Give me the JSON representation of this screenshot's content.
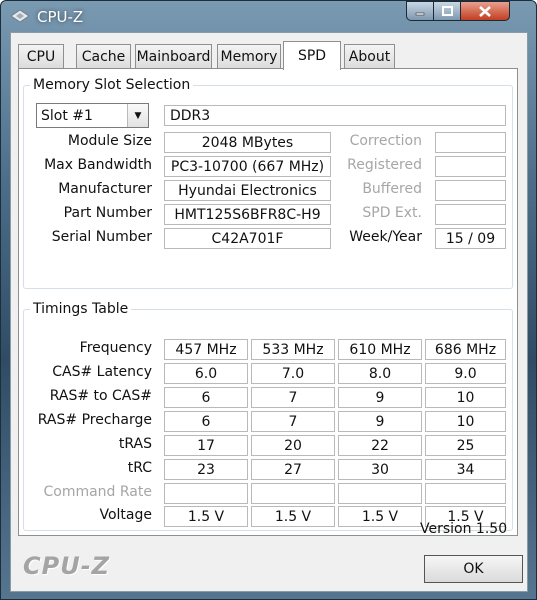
{
  "window": {
    "title": "CPU-Z"
  },
  "tabs": [
    "CPU",
    "Cache",
    "Mainboard",
    "Memory",
    "SPD",
    "About"
  ],
  "slot": {
    "group_title": "Memory Slot Selection",
    "selected": "Slot #1",
    "type": "DDR3",
    "labels": {
      "module_size": "Module Size",
      "max_bandwidth": "Max Bandwidth",
      "manufacturer": "Manufacturer",
      "part_number": "Part Number",
      "serial_number": "Serial Number",
      "correction": "Correction",
      "registered": "Registered",
      "buffered": "Buffered",
      "spd_ext": "SPD Ext.",
      "week_year": "Week/Year"
    },
    "values": {
      "module_size": "2048 MBytes",
      "max_bandwidth": "PC3-10700 (667 MHz)",
      "manufacturer": "Hyundai Electronics",
      "part_number": "HMT125S6BFR8C-H9",
      "serial_number": "C42A701F",
      "week_year": "15 / 09"
    }
  },
  "timings": {
    "group_title": "Timings Table",
    "rows": [
      {
        "label": "Frequency",
        "values": [
          "457 MHz",
          "533 MHz",
          "610 MHz",
          "686 MHz"
        ]
      },
      {
        "label": "CAS# Latency",
        "values": [
          "6.0",
          "7.0",
          "8.0",
          "9.0"
        ]
      },
      {
        "label": "RAS# to CAS#",
        "values": [
          "6",
          "7",
          "9",
          "10"
        ]
      },
      {
        "label": "RAS# Precharge",
        "values": [
          "6",
          "7",
          "9",
          "10"
        ]
      },
      {
        "label": "tRAS",
        "values": [
          "17",
          "20",
          "22",
          "25"
        ]
      },
      {
        "label": "tRC",
        "values": [
          "23",
          "27",
          "30",
          "34"
        ]
      },
      {
        "label": "Command Rate",
        "values": [
          "",
          "",
          "",
          ""
        ]
      },
      {
        "label": "Voltage",
        "values": [
          "1.5 V",
          "1.5 V",
          "1.5 V",
          "1.5 V"
        ]
      }
    ]
  },
  "footer": {
    "version": "Version 1.50",
    "logo": "CPU-Z",
    "ok_label": "OK"
  }
}
